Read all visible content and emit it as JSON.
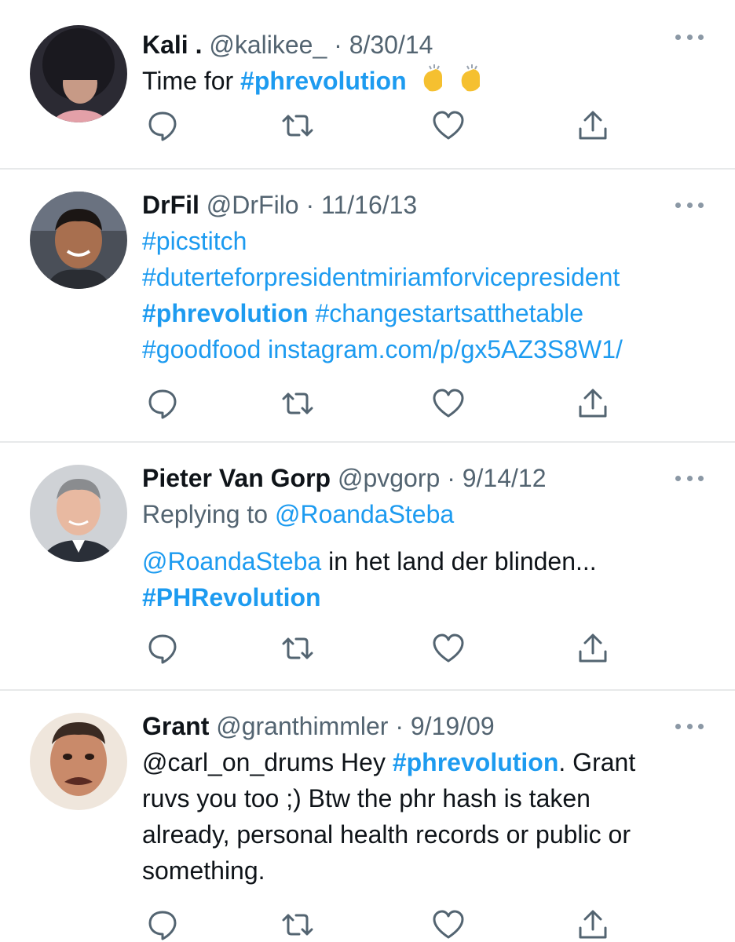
{
  "tweets": [
    {
      "name": "Kali .",
      "handle": "@kalikee_",
      "date": "8/30/14",
      "text_plain": "Time for",
      "text_tag": "#phrevolution",
      "emoji_icon": "clapping-hands-icon"
    },
    {
      "name": "DrFil",
      "handle": "@DrFilo",
      "date": "11/16/13",
      "line1": "#picstitch",
      "line2": "#duterteforpresidentmiriamforvicepresident",
      "line3_tag_bold": "#phrevolution",
      "line3_tag": "#changestartsatthetable",
      "line4_tag": "#goodfood",
      "line4_link": "instagram.com/p/gx5AZ3S8W1/"
    },
    {
      "name": "Pieter Van Gorp",
      "handle": "@pvgorp",
      "date": "9/14/12",
      "replying_label": "Replying to",
      "replying_to": "@RoandaSteba",
      "mention": "@RoandaSteba",
      "text_plain": "in het land der blinden...",
      "text_tag": "#PHRevolution"
    },
    {
      "name": "Grant",
      "handle": "@granthimmler",
      "date": "9/19/09",
      "line1_plain": "@carl_on_drums Hey",
      "line1_tag": "#phrevolution",
      "line1_tail": ". Grant",
      "line2": "ruvs you too ;) Btw the phr hash is taken",
      "line3": "already, personal health records or public or",
      "line4": "something."
    }
  ],
  "separator": "·",
  "icons": {
    "reply": "reply-icon",
    "retweet": "retweet-icon",
    "like": "like-icon",
    "share": "share-icon",
    "more": "more-options-icon"
  },
  "colors": {
    "link": "#1d9bf0",
    "muted": "#536471",
    "text": "#0f1419",
    "divider": "#e7e9ea"
  }
}
